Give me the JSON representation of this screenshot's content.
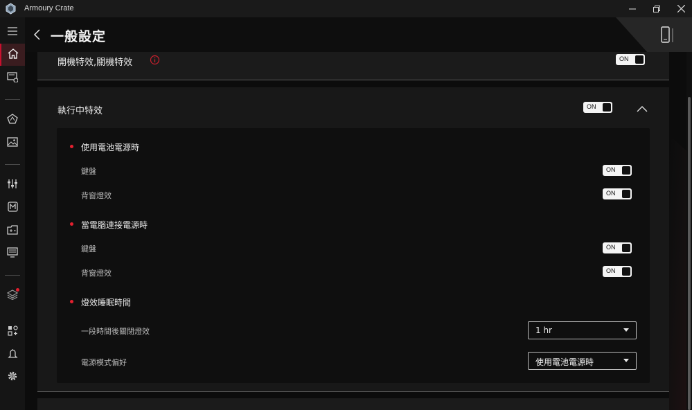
{
  "window": {
    "app_title": "Armoury Crate",
    "logo_icon": "rog-logo-icon",
    "minimize_icon": "minimize-icon",
    "restore_icon": "restore-icon",
    "close_icon": "close-icon"
  },
  "sidebar": {
    "items": [
      {
        "icon": "menu-icon"
      },
      {
        "icon": "home-icon",
        "active": true
      },
      {
        "icon": "device-icon"
      },
      {
        "icon": "aura-icon"
      },
      {
        "icon": "gallery-icon"
      },
      {
        "icon": "equalizer-icon"
      },
      {
        "icon": "armoury-m-icon"
      },
      {
        "icon": "game-library-icon"
      },
      {
        "icon": "monitor-icon"
      },
      {
        "icon": "layers-icon",
        "badge": true
      },
      {
        "icon": "add-widget-icon"
      },
      {
        "icon": "notification-icon"
      },
      {
        "icon": "settings-icon"
      }
    ]
  },
  "header": {
    "title": "一般設定",
    "back_icon": "back-arrow-icon",
    "device_icon": "phone-device-icon"
  },
  "boot_effects": {
    "label": "開機特效,關機特效",
    "toggle": "ON",
    "info_icon": "info-icon"
  },
  "running_effects": {
    "label": "執行中特效",
    "toggle": "ON",
    "collapse_icon": "chevron-up-icon",
    "battery_group": {
      "title": "使用電池電源時",
      "keyboard_label": "鍵盤",
      "keyboard_toggle": "ON",
      "backlight_label": "背窗燈效",
      "backlight_toggle": "ON"
    },
    "ac_group": {
      "title": "當電腦連接電源時",
      "keyboard_label": "鍵盤",
      "keyboard_toggle": "ON",
      "backlight_label": "背窗燈效",
      "backlight_toggle": "ON"
    },
    "sleep_group": {
      "title": "燈效睡眠時間",
      "timeout_label": "一段時間後關閉燈效",
      "timeout_value": "1 hr",
      "power_mode_label": "電源模式偏好",
      "power_mode_value": "使用電池電源時"
    }
  },
  "colors": {
    "accent_red": "#e4202f",
    "active_bg": "#3a1c1f",
    "card_bg": "#181818"
  }
}
